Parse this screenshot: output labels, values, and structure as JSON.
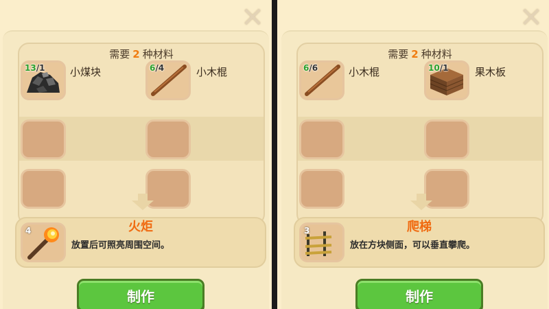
{
  "left": {
    "close_icon": "close-icon",
    "header": {
      "prefix": "需要",
      "count": "2",
      "suffix": "种材料"
    },
    "materials": [
      {
        "have": "13",
        "need": "1",
        "name": "小煤块",
        "icon": "coal-icon"
      },
      {
        "have": "6",
        "need": "4",
        "name": "小木棍",
        "icon": "stick-icon"
      }
    ],
    "result": {
      "count": "4",
      "name": "火炬",
      "desc": "放置后可照亮周围空间。",
      "icon": "torch-icon"
    },
    "craft_label": "制作"
  },
  "right": {
    "close_icon": "close-icon",
    "header": {
      "prefix": "需要",
      "count": "2",
      "suffix": "种材料"
    },
    "materials": [
      {
        "have": "6",
        "need": "6",
        "name": "小木棍",
        "icon": "stick-icon"
      },
      {
        "have": "10",
        "need": "1",
        "name": "果木板",
        "icon": "plank-icon"
      }
    ],
    "result": {
      "count": "3",
      "name": "爬梯",
      "desc": "放在方块侧面，可以垂直攀爬。",
      "icon": "ladder-icon"
    },
    "craft_label": "制作"
  },
  "colors": {
    "accent_orange": "#f07c10",
    "have_green": "#2aa02a",
    "button_green": "#5cc63f"
  }
}
